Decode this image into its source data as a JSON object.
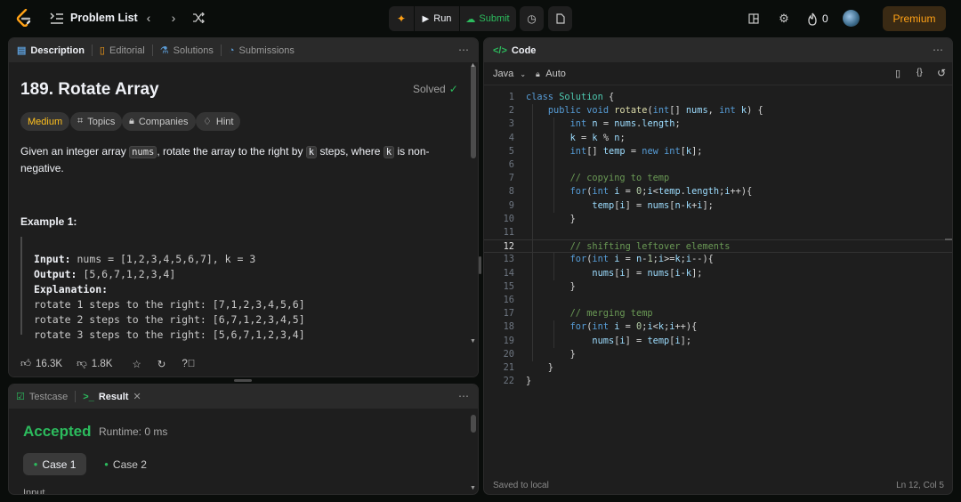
{
  "topbar": {
    "problem_list": "Problem List",
    "run": "Run",
    "submit": "Submit",
    "fire_count": "0",
    "premium": "Premium"
  },
  "left_panel": {
    "tabs": [
      {
        "label": "Description"
      },
      {
        "label": "Editorial"
      },
      {
        "label": "Solutions"
      },
      {
        "label": "Submissions"
      }
    ],
    "title": "189. Rotate Array",
    "solved": "Solved",
    "tags": [
      "Medium",
      "Topics",
      "Companies",
      "Hint"
    ],
    "statement": {
      "p1": "Given an integer array ",
      "c1": "nums",
      "p2": ", rotate the array to the right by ",
      "c2": "k",
      "p3": " steps, where ",
      "c3": "k",
      "p4": " is non-",
      "p5": "negative."
    },
    "example_title": "Example 1:",
    "example": {
      "input_label": "Input:",
      "input_value": "nums = [1,2,3,4,5,6,7], k = 3",
      "output_label": "Output:",
      "output_value": "[5,6,7,1,2,3,4]",
      "explanation_label": "Explanation:",
      "lines": [
        "rotate 1 steps to the right: [7,1,2,3,4,5,6]",
        "rotate 2 steps to the right: [6,7,1,2,3,4,5]",
        "rotate 3 steps to the right: [5,6,7,1,2,3,4]"
      ]
    },
    "likes": "16.3K",
    "dislikes": "1.8K"
  },
  "bottom_panel": {
    "tab_testcase": "Testcase",
    "tab_result": "Result",
    "status": "Accepted",
    "runtime": "Runtime: 0 ms",
    "cases": [
      "Case 1",
      "Case 2"
    ],
    "input_label": "Input"
  },
  "code_panel": {
    "title": "Code",
    "language": "Java",
    "mode": "Auto",
    "saved": "Saved to local",
    "cursor": "Ln 12, Col 5",
    "active_line": 12,
    "lines": [
      "class Solution {",
      "    public void rotate(int[] nums, int k) {",
      "        int n = nums.length;",
      "        k = k % n;",
      "        int[] temp = new int[k];",
      "",
      "        // copying to temp",
      "        for(int i = 0;i<temp.length;i++){",
      "            temp[i] = nums[n-k+i];",
      "        }",
      "",
      "        // shifting leftover elements",
      "        for(int i = n-1;i>=k;i--){",
      "            nums[i] = nums[i-k];",
      "        }",
      "",
      "        // merging temp",
      "        for(int i = 0;i<k;i++){",
      "            nums[i] = temp[i];",
      "        }",
      "    }",
      "}"
    ]
  },
  "colors": {
    "accepted": "#2cbb5d",
    "medium": "#ffc01e",
    "premium_text": "#ffa116",
    "submit": "#2cbb5d"
  },
  "icons": [
    "logo-icon",
    "list-icon",
    "chevron-left-icon",
    "chevron-right-icon",
    "shuffle-icon",
    "debug-icon",
    "play-icon",
    "upload-icon",
    "timer-icon",
    "note-icon",
    "layout-icon",
    "settings-icon",
    "fire-icon",
    "avatar"
  ]
}
